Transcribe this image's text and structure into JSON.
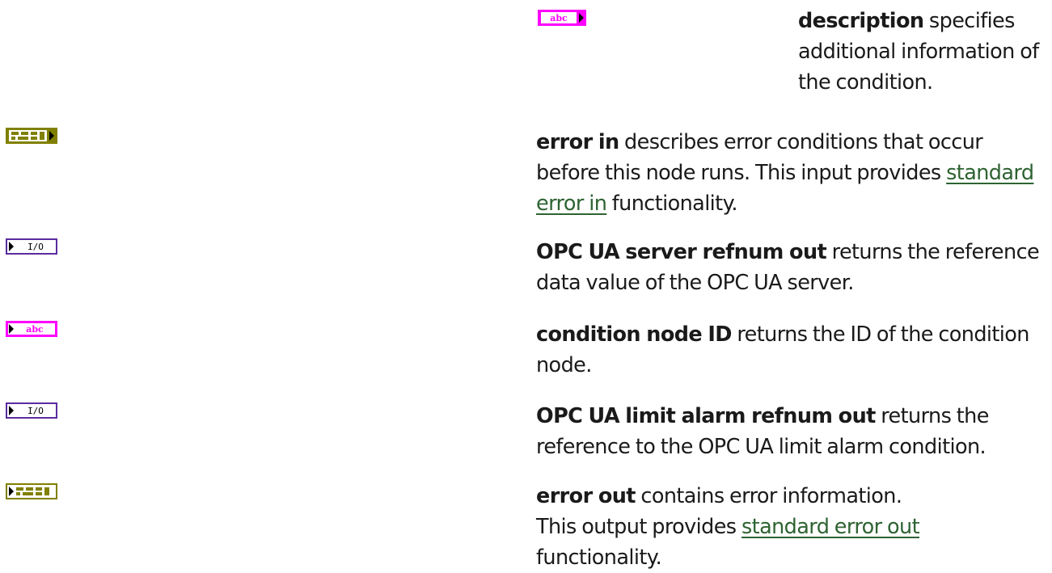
{
  "params": {
    "description": {
      "icon": "string-input-terminal-icon",
      "term": "description",
      "text": " specifies additional information of the condition."
    },
    "error_in": {
      "icon": "error-cluster-input-terminal-icon",
      "term": "error in",
      "text1": " describes error conditions that occur before this node runs. This input provides ",
      "link": "standard error in",
      "text2": " functionality."
    },
    "server_refnum_out": {
      "icon": "io-refnum-output-terminal-icon",
      "term": "OPC UA server refnum out",
      "text": " returns the reference data value of the OPC UA server."
    },
    "condition_node_id": {
      "icon": "string-output-terminal-icon",
      "term": "condition node ID",
      "text": " returns the ID of the condition node."
    },
    "limit_alarm_refnum_out": {
      "icon": "io-refnum-output-terminal-icon",
      "term": "OPC UA limit alarm refnum out",
      "text": " returns the reference to the OPC UA limit alarm condition."
    },
    "error_out": {
      "icon": "error-cluster-output-terminal-icon",
      "term": "error out",
      "text1": " contains error information. This output provides ",
      "link": "standard error out",
      "text2": " functionality."
    }
  },
  "colors": {
    "string_terminal": "#ff00ff",
    "error_terminal": "#808000",
    "refnum_terminal": "#5a2c9e",
    "link": "#2e6332"
  }
}
